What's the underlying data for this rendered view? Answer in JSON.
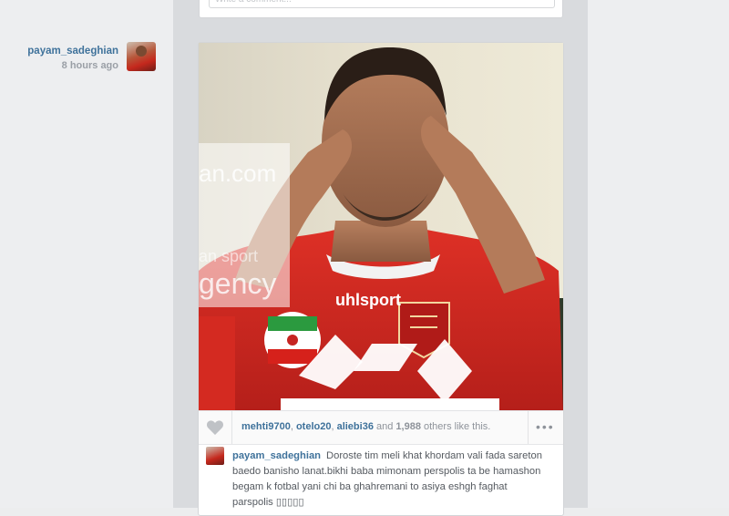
{
  "feed_item": {
    "author": {
      "username": "payam_sadeghian",
      "time_ago": "8 hours ago"
    },
    "likes": {
      "users": [
        "mehti9700",
        "otelo20",
        "aliebi36"
      ],
      "separator": ", ",
      "and_text": " and ",
      "others_count": "1,988",
      "others_suffix": " others like this."
    },
    "caption": {
      "username": "payam_sadeghian",
      "text": "Doroste tim meli khat khordam vali fada sareton baedo banisho lanat.bikhi baba mimonam perspolis ta be hamashon begam k fotbal yani chi ba ghahremani to asiya eshgh faghat parspolis ▯▯▯▯▯"
    },
    "photo": {
      "watermark_lines": [
        "an.com",
        "an sport",
        "gency"
      ],
      "jersey_brand": "uhlsport"
    }
  },
  "previous_item": {
    "comment_placeholder": "Write a comment..."
  },
  "icons": {
    "like": "heart-icon",
    "more": "more-options-icon"
  },
  "colors": {
    "link_blue": "#3f729b",
    "muted_text": "#8e939a",
    "jersey_red": "#d7261e"
  }
}
